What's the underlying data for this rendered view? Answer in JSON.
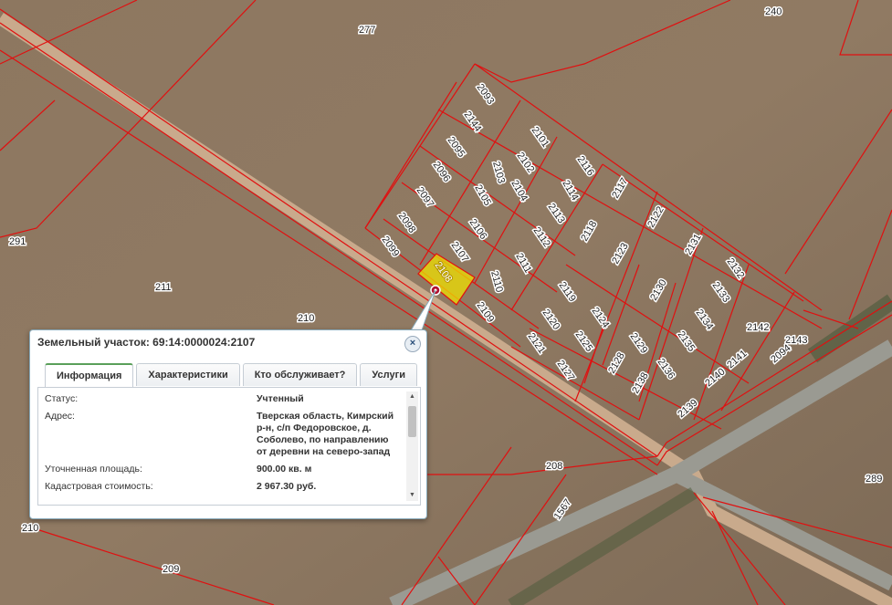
{
  "popup": {
    "title": "Земельный участок: 69:14:0000024:2107",
    "close_label": "×",
    "tabs": [
      {
        "label": "Информация",
        "active": true
      },
      {
        "label": "Характеристики",
        "active": false
      },
      {
        "label": "Кто обслуживает?",
        "active": false
      },
      {
        "label": "Услуги",
        "active": false
      }
    ],
    "rows": [
      {
        "key": "Статус:",
        "value": "Учтенный"
      },
      {
        "key": "Адрес:",
        "value": "Тверская область, Кимрский р-н, с/п Федоровское, д. Соболево, по направлению от деревни на северо-запад"
      },
      {
        "key": "Уточненная площадь:",
        "value": "900.00 кв. м"
      },
      {
        "key": "Кадастровая стоимость:",
        "value": "2 967.30 руб."
      }
    ]
  },
  "parcel_labels": [
    "277",
    "240",
    "291",
    "211",
    "210",
    "208",
    "209",
    "210",
    "289",
    "1567",
    "2093",
    "2144",
    "2095",
    "2096",
    "2097",
    "2098",
    "2099",
    "2101",
    "2102",
    "2103",
    "2104",
    "2105",
    "2106",
    "2107",
    "2108",
    "2109",
    "2110",
    "2111",
    "2112",
    "2113",
    "2114",
    "2116",
    "2117",
    "2118",
    "2119",
    "2120",
    "2121",
    "2122",
    "2123",
    "2124",
    "2125",
    "2127",
    "2128",
    "2129",
    "2130",
    "2131",
    "2132",
    "2133",
    "2134",
    "2135",
    "2136",
    "2138",
    "2139",
    "2140",
    "2141",
    "2142",
    "2143",
    "2094"
  ],
  "colors": {
    "boundary": "#e01010",
    "selected": "#f0e000",
    "road": "#c8a88a"
  }
}
